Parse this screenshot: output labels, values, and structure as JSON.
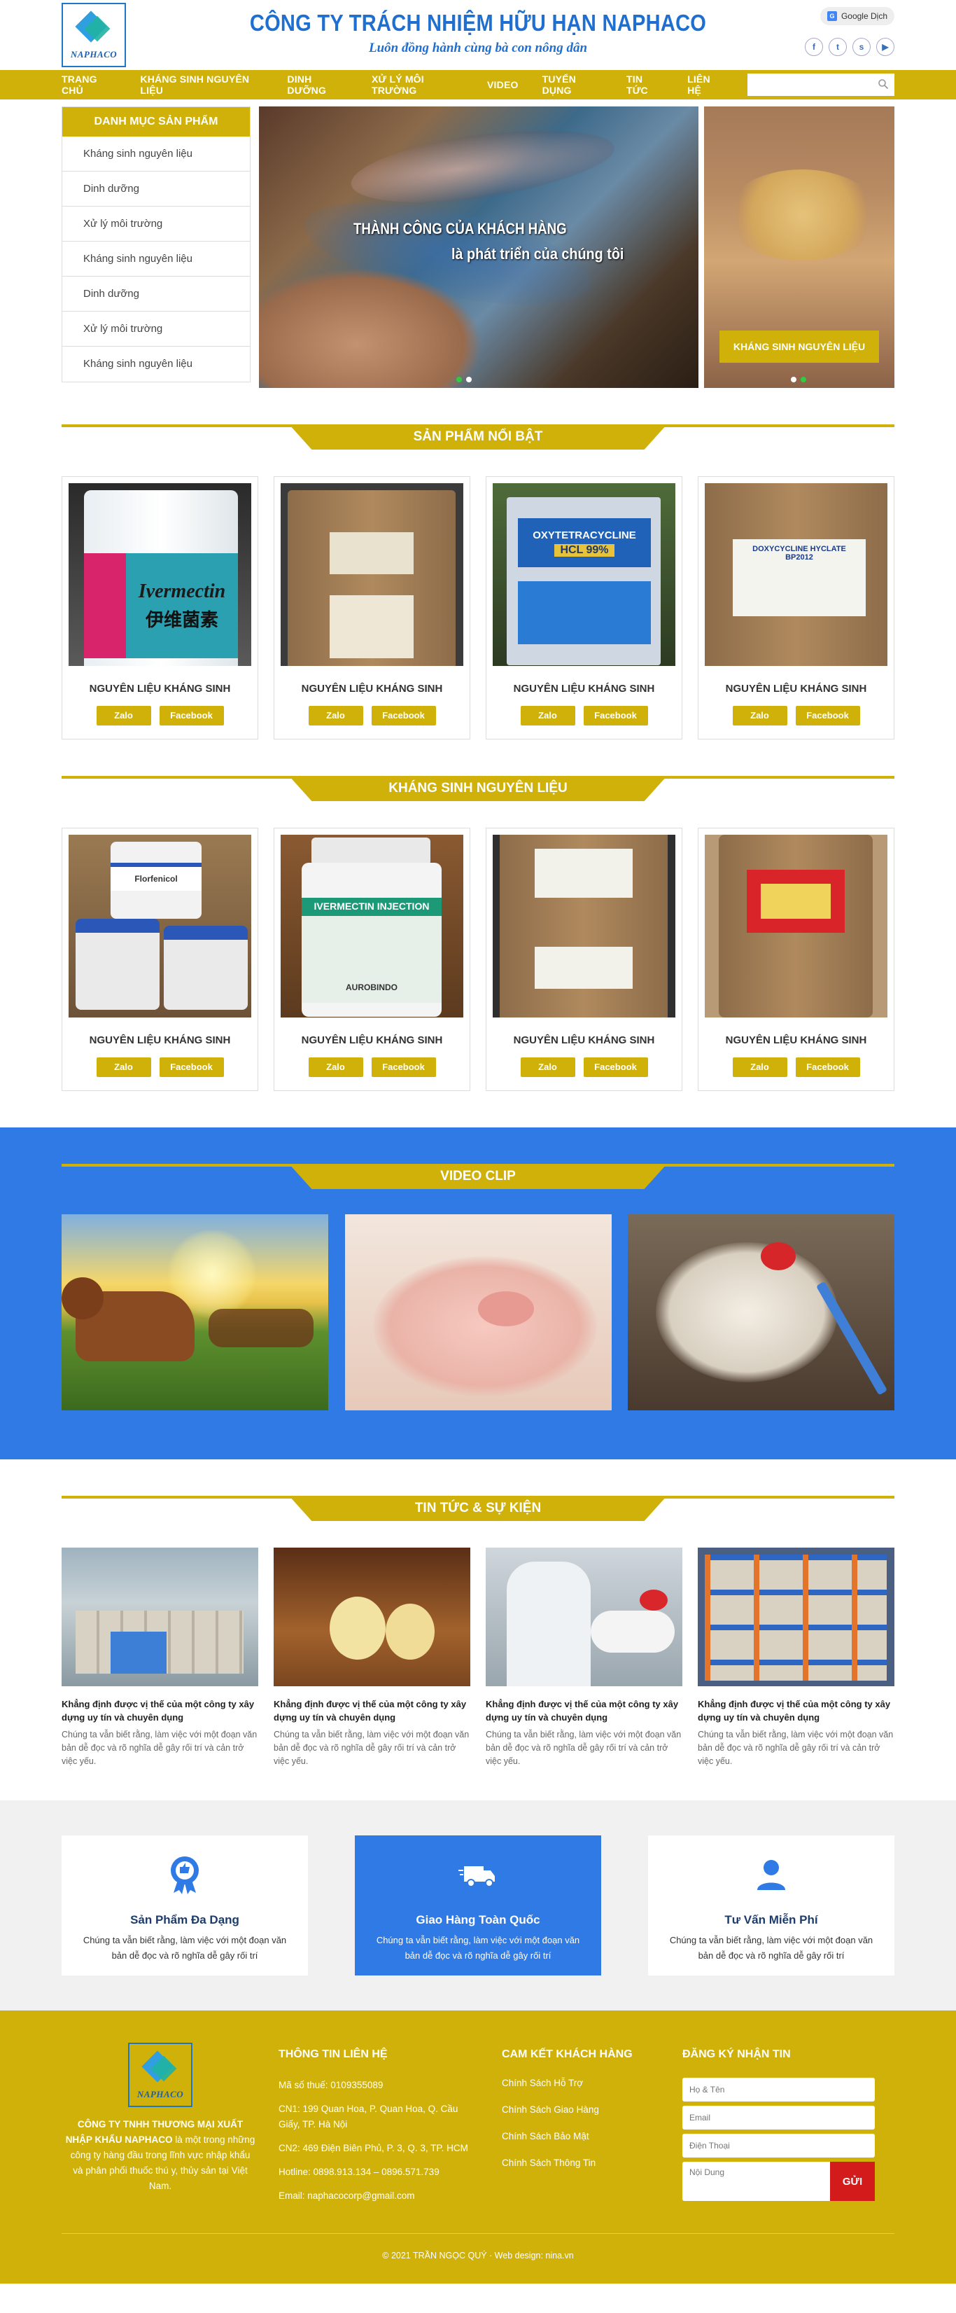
{
  "header": {
    "logo_text": "NAPHACO",
    "company_name": "CÔNG TY TRÁCH NHIỆM HỮU HẠN NAPHACO",
    "slogan": "Luôn đồng hành cùng bà con nông dân",
    "translate_label": "Google Dịch",
    "social_icons": [
      "facebook-icon",
      "twitter-icon",
      "skype-icon",
      "youtube-icon"
    ]
  },
  "nav": {
    "items": [
      "TRANG CHỦ",
      "KHÁNG SINH NGUYÊN LIỆU",
      "DINH DƯỠNG",
      "XỬ LÝ MÔI TRƯỜNG",
      "VIDEO",
      "TUYỂN DỤNG",
      "TIN TỨC",
      "LIÊN HỆ"
    ],
    "search_placeholder": ""
  },
  "sidebar": {
    "title": "DANH MỤC SẢN PHẨM",
    "items": [
      "Kháng sinh nguyên liệu",
      "Dinh dưỡng",
      "Xử lý môi trường",
      "Kháng sinh nguyên liệu",
      "Dinh dưỡng",
      "Xử lý môi trường",
      "Kháng sinh nguyên liệu"
    ]
  },
  "slider": {
    "line1": "THÀNH CÔNG CỦA KHÁCH HÀNG",
    "line2": "là phát triển của chúng tôi"
  },
  "side_banner": {
    "button": "KHÁNG SINH NGUYÊN LIỆU"
  },
  "featured": {
    "title": "SẢN PHẨM NỔI BẬT",
    "products": [
      {
        "name": "NGUYÊN LIỆU KHÁNG SINH",
        "label": "Ivermectin",
        "sub": "伊维菌素"
      },
      {
        "name": "NGUYÊN LIỆU KHÁNG SINH",
        "label": "",
        "sub": ""
      },
      {
        "name": "NGUYÊN LIỆU KHÁNG SINH",
        "label": "OXYTETRACYCLINE",
        "sub": "HCL 99%"
      },
      {
        "name": "NGUYÊN LIỆU KHÁNG SINH",
        "label": "DOXYCYCLINE HYCLATE BP2012",
        "sub": ""
      }
    ]
  },
  "antibiotics": {
    "title": "KHÁNG SINH NGUYÊN LIỆU",
    "products": [
      {
        "name": "NGUYÊN LIỆU KHÁNG SINH",
        "label": "Florfenicol",
        "sub": ""
      },
      {
        "name": "NGUYÊN LIỆU KHÁNG SINH",
        "label": "IVERMECTIN INJECTION",
        "sub": "AUROBINDO"
      },
      {
        "name": "NGUYÊN LIỆU KHÁNG SINH",
        "label": "",
        "sub": ""
      },
      {
        "name": "NGUYÊN LIỆU KHÁNG SINH",
        "label": "",
        "sub": ""
      }
    ]
  },
  "buttons": {
    "zalo": "Zalo",
    "facebook": "Facebook"
  },
  "video": {
    "title": "VIDEO CLIP"
  },
  "news": {
    "title": "TIN TỨC & SỰ KIỆN",
    "items": [
      {
        "title": "Khẳng định được vị thế của một công ty xây dựng uy tín và chuyên dụng",
        "desc": "Chúng ta vẫn biết rằng, làm việc với một đoạn văn bản dễ đọc và rõ nghĩa dễ gây rối trí và cản trở việc yếu."
      },
      {
        "title": "Khẳng định được vị thế của một công ty xây dựng uy tín và chuyên dụng",
        "desc": "Chúng ta vẫn biết rằng, làm việc với một đoạn văn bản dễ đọc và rõ nghĩa dễ gây rối trí và cản trở việc yếu."
      },
      {
        "title": "Khẳng định được vị thế của một công ty xây dựng uy tín và chuyên dụng",
        "desc": "Chúng ta vẫn biết rằng, làm việc với một đoạn văn bản dễ đọc và rõ nghĩa dễ gây rối trí và cản trở việc yếu."
      },
      {
        "title": "Khẳng định được vị thế của một công ty xây dựng uy tín và chuyên dụng",
        "desc": "Chúng ta vẫn biết rằng, làm việc với một đoạn văn bản dễ đọc và rõ nghĩa dễ gây rối trí và cản trở việc yếu."
      }
    ]
  },
  "features": [
    {
      "title": "Sản Phẩm Đa Dạng",
      "desc": "Chúng ta vẫn biết rằng, làm việc với một đoạn văn bản dễ đọc và rõ nghĩa dễ gây rối trí",
      "icon": "award-badge-icon"
    },
    {
      "title": "Giao Hàng Toàn Quốc",
      "desc": "Chúng ta vẫn biết rằng, làm việc với một đoạn văn bản dễ đọc và rõ nghĩa dễ gây rối trí",
      "icon": "delivery-truck-icon"
    },
    {
      "title": "Tư Vấn Miễn Phí",
      "desc": "Chúng ta vẫn biết rằng, làm việc với một đoạn văn bản dễ đọc và rõ nghĩa dễ gây rối trí",
      "icon": "user-icon"
    }
  ],
  "footer": {
    "about_bold": "CÔNG TY TNHH THƯƠNG MẠI XUẤT NHẬP KHẨU NAPHACO",
    "about_rest": " là một trong những công ty hàng đầu trong lĩnh vực nhập khẩu và phân phối thuốc thú y, thủy sản tại Việt Nam.",
    "contact_title": "THÔNG TIN LIÊN HỆ",
    "contact_lines": [
      "Mã số thuế: 0109355089",
      "CN1: 199 Quan Hoa, P. Quan Hoa, Q. Cầu Giấy, TP. Hà Nội",
      "CN2: 469 Điện Biên Phủ, P. 3, Q. 3, TP. HCM",
      "Hotline: 0898.913.134 – 0896.571.739",
      "Email: naphacocorp@gmail.com"
    ],
    "commit_title": "CAM KẾT KHÁCH HÀNG",
    "commit_links": [
      "Chính Sách Hỗ Trợ",
      "Chính Sách Giao Hàng",
      "Chính Sách Bảo Mật",
      "Chính Sách Thông Tin"
    ],
    "subscribe_title": "ĐĂNG KÝ NHẬN TIN",
    "placeholders": {
      "name": "Họ & Tên",
      "email": "Email",
      "phone": "Điện Thoại",
      "content": "Nội Dung"
    },
    "send": "GỬI",
    "copyright": "© 2021 TRẦN NGỌC QUÝ · Web design: nina.vn"
  },
  "colors": {
    "brand_yellow": "#cfb10a",
    "brand_blue": "#2f7ae5",
    "heading_blue": "#1f6fd1",
    "send_red": "#d41b1b"
  }
}
